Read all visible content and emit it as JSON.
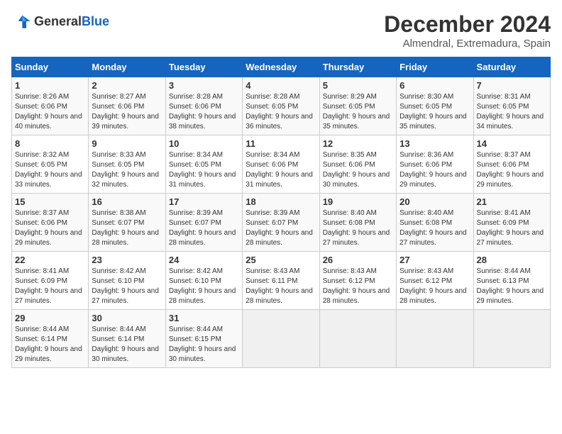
{
  "logo": {
    "text_general": "General",
    "text_blue": "Blue"
  },
  "title": "December 2024",
  "subtitle": "Almendral, Extremadura, Spain",
  "weekdays": [
    "Sunday",
    "Monday",
    "Tuesday",
    "Wednesday",
    "Thursday",
    "Friday",
    "Saturday"
  ],
  "weeks": [
    [
      {
        "day": "1",
        "sunrise": "Sunrise: 8:26 AM",
        "sunset": "Sunset: 6:06 PM",
        "daylight": "Daylight: 9 hours and 40 minutes."
      },
      {
        "day": "2",
        "sunrise": "Sunrise: 8:27 AM",
        "sunset": "Sunset: 6:06 PM",
        "daylight": "Daylight: 9 hours and 39 minutes."
      },
      {
        "day": "3",
        "sunrise": "Sunrise: 8:28 AM",
        "sunset": "Sunset: 6:06 PM",
        "daylight": "Daylight: 9 hours and 38 minutes."
      },
      {
        "day": "4",
        "sunrise": "Sunrise: 8:28 AM",
        "sunset": "Sunset: 6:05 PM",
        "daylight": "Daylight: 9 hours and 36 minutes."
      },
      {
        "day": "5",
        "sunrise": "Sunrise: 8:29 AM",
        "sunset": "Sunset: 6:05 PM",
        "daylight": "Daylight: 9 hours and 35 minutes."
      },
      {
        "day": "6",
        "sunrise": "Sunrise: 8:30 AM",
        "sunset": "Sunset: 6:05 PM",
        "daylight": "Daylight: 9 hours and 35 minutes."
      },
      {
        "day": "7",
        "sunrise": "Sunrise: 8:31 AM",
        "sunset": "Sunset: 6:05 PM",
        "daylight": "Daylight: 9 hours and 34 minutes."
      }
    ],
    [
      {
        "day": "8",
        "sunrise": "Sunrise: 8:32 AM",
        "sunset": "Sunset: 6:05 PM",
        "daylight": "Daylight: 9 hours and 33 minutes."
      },
      {
        "day": "9",
        "sunrise": "Sunrise: 8:33 AM",
        "sunset": "Sunset: 6:05 PM",
        "daylight": "Daylight: 9 hours and 32 minutes."
      },
      {
        "day": "10",
        "sunrise": "Sunrise: 8:34 AM",
        "sunset": "Sunset: 6:05 PM",
        "daylight": "Daylight: 9 hours and 31 minutes."
      },
      {
        "day": "11",
        "sunrise": "Sunrise: 8:34 AM",
        "sunset": "Sunset: 6:06 PM",
        "daylight": "Daylight: 9 hours and 31 minutes."
      },
      {
        "day": "12",
        "sunrise": "Sunrise: 8:35 AM",
        "sunset": "Sunset: 6:06 PM",
        "daylight": "Daylight: 9 hours and 30 minutes."
      },
      {
        "day": "13",
        "sunrise": "Sunrise: 8:36 AM",
        "sunset": "Sunset: 6:06 PM",
        "daylight": "Daylight: 9 hours and 29 minutes."
      },
      {
        "day": "14",
        "sunrise": "Sunrise: 8:37 AM",
        "sunset": "Sunset: 6:06 PM",
        "daylight": "Daylight: 9 hours and 29 minutes."
      }
    ],
    [
      {
        "day": "15",
        "sunrise": "Sunrise: 8:37 AM",
        "sunset": "Sunset: 6:06 PM",
        "daylight": "Daylight: 9 hours and 29 minutes."
      },
      {
        "day": "16",
        "sunrise": "Sunrise: 8:38 AM",
        "sunset": "Sunset: 6:07 PM",
        "daylight": "Daylight: 9 hours and 28 minutes."
      },
      {
        "day": "17",
        "sunrise": "Sunrise: 8:39 AM",
        "sunset": "Sunset: 6:07 PM",
        "daylight": "Daylight: 9 hours and 28 minutes."
      },
      {
        "day": "18",
        "sunrise": "Sunrise: 8:39 AM",
        "sunset": "Sunset: 6:07 PM",
        "daylight": "Daylight: 9 hours and 28 minutes."
      },
      {
        "day": "19",
        "sunrise": "Sunrise: 8:40 AM",
        "sunset": "Sunset: 6:08 PM",
        "daylight": "Daylight: 9 hours and 27 minutes."
      },
      {
        "day": "20",
        "sunrise": "Sunrise: 8:40 AM",
        "sunset": "Sunset: 6:08 PM",
        "daylight": "Daylight: 9 hours and 27 minutes."
      },
      {
        "day": "21",
        "sunrise": "Sunrise: 8:41 AM",
        "sunset": "Sunset: 6:09 PM",
        "daylight": "Daylight: 9 hours and 27 minutes."
      }
    ],
    [
      {
        "day": "22",
        "sunrise": "Sunrise: 8:41 AM",
        "sunset": "Sunset: 6:09 PM",
        "daylight": "Daylight: 9 hours and 27 minutes."
      },
      {
        "day": "23",
        "sunrise": "Sunrise: 8:42 AM",
        "sunset": "Sunset: 6:10 PM",
        "daylight": "Daylight: 9 hours and 27 minutes."
      },
      {
        "day": "24",
        "sunrise": "Sunrise: 8:42 AM",
        "sunset": "Sunset: 6:10 PM",
        "daylight": "Daylight: 9 hours and 28 minutes."
      },
      {
        "day": "25",
        "sunrise": "Sunrise: 8:43 AM",
        "sunset": "Sunset: 6:11 PM",
        "daylight": "Daylight: 9 hours and 28 minutes."
      },
      {
        "day": "26",
        "sunrise": "Sunrise: 8:43 AM",
        "sunset": "Sunset: 6:12 PM",
        "daylight": "Daylight: 9 hours and 28 minutes."
      },
      {
        "day": "27",
        "sunrise": "Sunrise: 8:43 AM",
        "sunset": "Sunset: 6:12 PM",
        "daylight": "Daylight: 9 hours and 28 minutes."
      },
      {
        "day": "28",
        "sunrise": "Sunrise: 8:44 AM",
        "sunset": "Sunset: 6:13 PM",
        "daylight": "Daylight: 9 hours and 29 minutes."
      }
    ],
    [
      {
        "day": "29",
        "sunrise": "Sunrise: 8:44 AM",
        "sunset": "Sunset: 6:14 PM",
        "daylight": "Daylight: 9 hours and 29 minutes."
      },
      {
        "day": "30",
        "sunrise": "Sunrise: 8:44 AM",
        "sunset": "Sunset: 6:14 PM",
        "daylight": "Daylight: 9 hours and 30 minutes."
      },
      {
        "day": "31",
        "sunrise": "Sunrise: 8:44 AM",
        "sunset": "Sunset: 6:15 PM",
        "daylight": "Daylight: 9 hours and 30 minutes."
      },
      null,
      null,
      null,
      null
    ]
  ]
}
